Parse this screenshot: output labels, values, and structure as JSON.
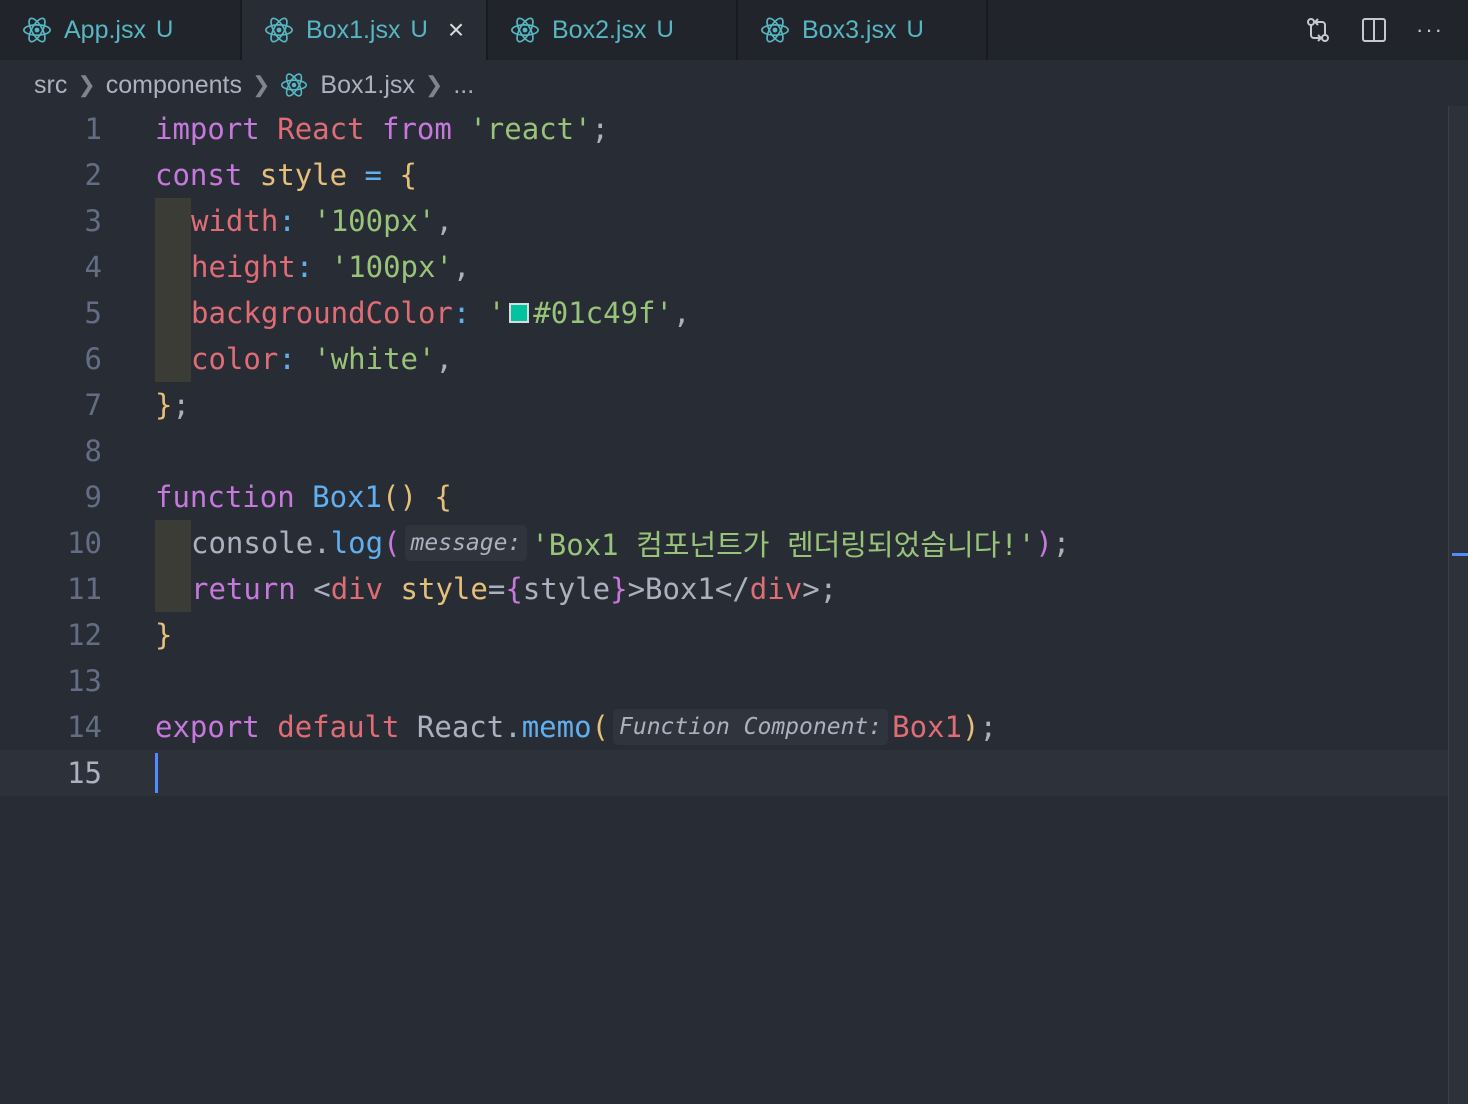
{
  "tabs": [
    {
      "label": "App.jsx",
      "status": "U",
      "active": false
    },
    {
      "label": "Box1.jsx",
      "status": "U",
      "active": true,
      "close": "×"
    },
    {
      "label": "Box2.jsx",
      "status": "U",
      "active": false
    },
    {
      "label": "Box3.jsx",
      "status": "U",
      "active": false
    }
  ],
  "toolbar": {
    "more": "···"
  },
  "breadcrumb": {
    "folder1": "src",
    "folder2": "components",
    "file": "Box1.jsx",
    "more": "..."
  },
  "colors": {
    "accent": "#528bff",
    "swatch": "#01c49f"
  },
  "code": {
    "line_numbers": [
      "1",
      "2",
      "3",
      "4",
      "5",
      "6",
      "7",
      "8",
      "9",
      "10",
      "11",
      "12",
      "13",
      "14",
      "15"
    ],
    "l1": {
      "kw": "import",
      "name": "React",
      "from": "from",
      "str": "'react'",
      "end": ";"
    },
    "l2": {
      "kw": "const",
      "name": "style",
      "eq": " = ",
      "brace": "{"
    },
    "l3": {
      "prop": "width",
      "colon": ": ",
      "str": "'100px'",
      "comma": ","
    },
    "l4": {
      "prop": "height",
      "colon": ": ",
      "str": "'100px'",
      "comma": ","
    },
    "l5": {
      "prop": "backgroundColor",
      "colon": ": ",
      "q": "'",
      "str": "#01c49f'",
      "comma": ","
    },
    "l6": {
      "prop": "color",
      "colon": ": ",
      "str": "'white'",
      "comma": ","
    },
    "l7": {
      "brace": "}",
      "end": ";"
    },
    "l9": {
      "kw": "function",
      "name": "Box1",
      "parens": "()",
      "brace": "{"
    },
    "l10": {
      "obj": "console",
      "dot": ".",
      "fn": "log",
      "open": "(",
      "hint": "message:",
      "str": "'Box1 컴포넌트가 렌더링되었습니다!'",
      "close": ")",
      "end": ";"
    },
    "l11": {
      "kw": "return",
      "lt": " <",
      "tag": "div",
      "attr": " style",
      "eq": "=",
      "ob": "{",
      "val": "style",
      "cb": "}",
      "gt": ">",
      "text": "Box1",
      "close_lt": "</",
      "close_tag": "div",
      "close_gt": ">",
      "end": ";"
    },
    "l12": {
      "brace": "}"
    },
    "l14": {
      "kw": "export",
      "kw2": "default",
      "obj": "React",
      "dot": ".",
      "fn": "memo",
      "open": "(",
      "hint": "Function Component:",
      "arg": "Box1",
      "close": ")",
      "end": ";"
    }
  }
}
